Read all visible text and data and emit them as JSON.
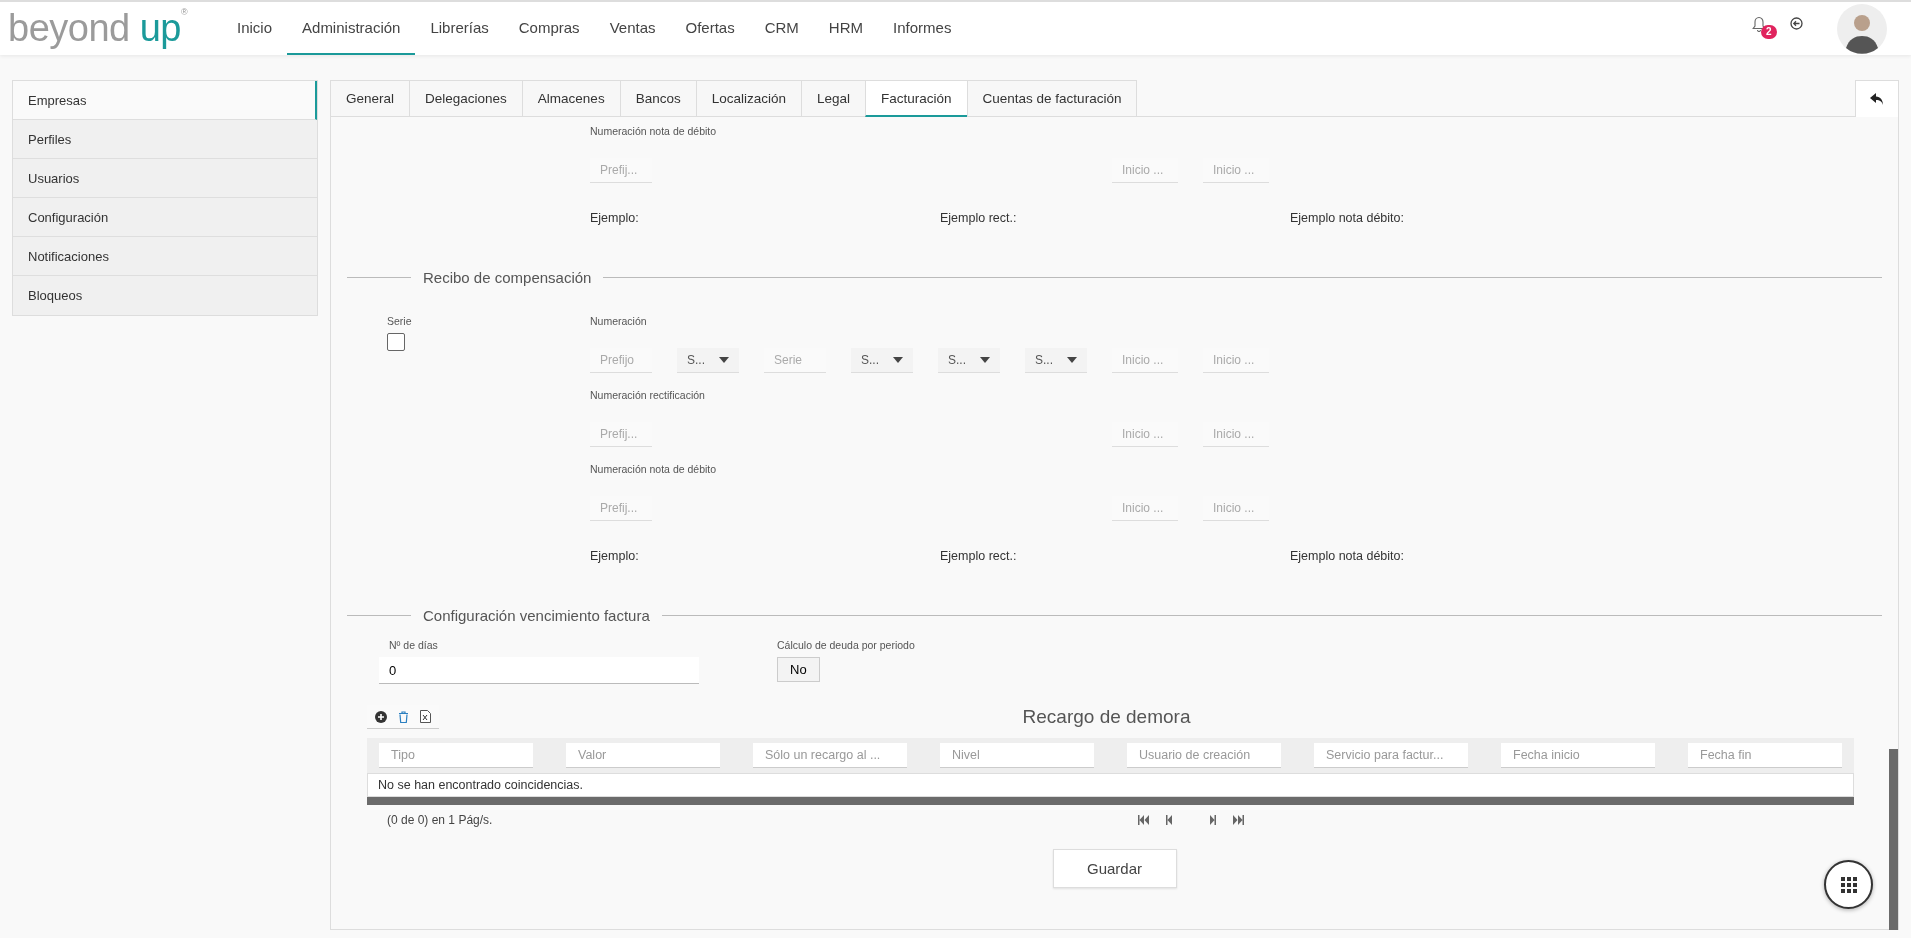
{
  "header": {
    "logo": {
      "word_1": "beyond",
      "word_2": "up",
      "mark": "®"
    },
    "nav": [
      {
        "label": "Inicio",
        "selected": false
      },
      {
        "label": "Administración",
        "selected": true
      },
      {
        "label": "Librerías",
        "selected": false
      },
      {
        "label": "Compras",
        "selected": false
      },
      {
        "label": "Ventas",
        "selected": false
      },
      {
        "label": "Ofertas",
        "selected": false
      },
      {
        "label": "CRM",
        "selected": false
      },
      {
        "label": "HRM",
        "selected": false
      },
      {
        "label": "Informes",
        "selected": false
      }
    ],
    "notifications": {
      "count": "2"
    }
  },
  "sidebar": {
    "items": [
      {
        "label": "Empresas",
        "selected": true
      },
      {
        "label": "Perfiles",
        "selected": false
      },
      {
        "label": "Usuarios",
        "selected": false
      },
      {
        "label": "Configuración",
        "selected": false
      },
      {
        "label": "Notificaciones",
        "selected": false
      },
      {
        "label": "Bloqueos",
        "selected": false
      }
    ]
  },
  "tabs": [
    {
      "label": "General",
      "selected": false
    },
    {
      "label": "Delegaciones",
      "selected": false
    },
    {
      "label": "Almacenes",
      "selected": false
    },
    {
      "label": "Bancos",
      "selected": false
    },
    {
      "label": "Localización",
      "selected": false
    },
    {
      "label": "Legal",
      "selected": false
    },
    {
      "label": "Facturación",
      "selected": true
    },
    {
      "label": "Cuentas de facturación",
      "selected": false
    }
  ],
  "partial_block": {
    "numberings": [
      {
        "label": "Numeración nota de débito",
        "fields": [
          {
            "kind": "text",
            "placeholder": "Prefij..."
          },
          {
            "kind": "text",
            "placeholder": "Inicio ..."
          },
          {
            "kind": "text",
            "placeholder": "Inicio ..."
          }
        ]
      }
    ],
    "examples": [
      "Ejemplo:",
      "Ejemplo rect.:",
      "Ejemplo nota débito:"
    ]
  },
  "recibo": {
    "title": "Recibo de compensación",
    "serie": {
      "label": "Serie",
      "checked": false
    },
    "numberings": [
      {
        "label": "Numeración",
        "fields": [
          {
            "kind": "text",
            "placeholder": "Prefijo"
          },
          {
            "kind": "select",
            "value": "S..."
          },
          {
            "kind": "text",
            "placeholder": "Serie"
          },
          {
            "kind": "select",
            "value": "S..."
          },
          {
            "kind": "select",
            "value": "S..."
          },
          {
            "kind": "select",
            "value": "S..."
          },
          {
            "kind": "text",
            "placeholder": "Inicio ..."
          },
          {
            "kind": "text",
            "placeholder": "Inicio ..."
          }
        ]
      },
      {
        "label": "Numeración rectificación",
        "fields": [
          {
            "kind": "text",
            "placeholder": "Prefij..."
          },
          {
            "kind": "text",
            "placeholder": "Inicio ..."
          },
          {
            "kind": "text",
            "placeholder": "Inicio ..."
          }
        ]
      },
      {
        "label": "Numeración nota de débito",
        "fields": [
          {
            "kind": "text",
            "placeholder": "Prefij..."
          },
          {
            "kind": "text",
            "placeholder": "Inicio ..."
          },
          {
            "kind": "text",
            "placeholder": "Inicio ..."
          }
        ]
      }
    ],
    "examples": [
      "Ejemplo:",
      "Ejemplo rect.:",
      "Ejemplo nota débito:"
    ]
  },
  "vencimiento": {
    "title": "Configuración vencimiento factura",
    "dias": {
      "label": "Nº de días",
      "value": "0"
    },
    "calculo": {
      "label": "Cálculo de deuda por periodo",
      "value": "No"
    }
  },
  "recargo": {
    "title": "Recargo de demora",
    "filters": [
      {
        "placeholder": "Tipo"
      },
      {
        "placeholder": "Valor"
      },
      {
        "placeholder": "Sólo un recargo al ..."
      },
      {
        "placeholder": "Nivel"
      },
      {
        "placeholder": "Usuario de creación"
      },
      {
        "placeholder": "Servicio para factur..."
      },
      {
        "placeholder": "Fecha inicio"
      },
      {
        "placeholder": "Fecha fin"
      }
    ],
    "empty_message": "No se han encontrado coincidencias.",
    "pager": "(0 de 0) en 1 Pág/s."
  },
  "save_button": "Guardar"
}
